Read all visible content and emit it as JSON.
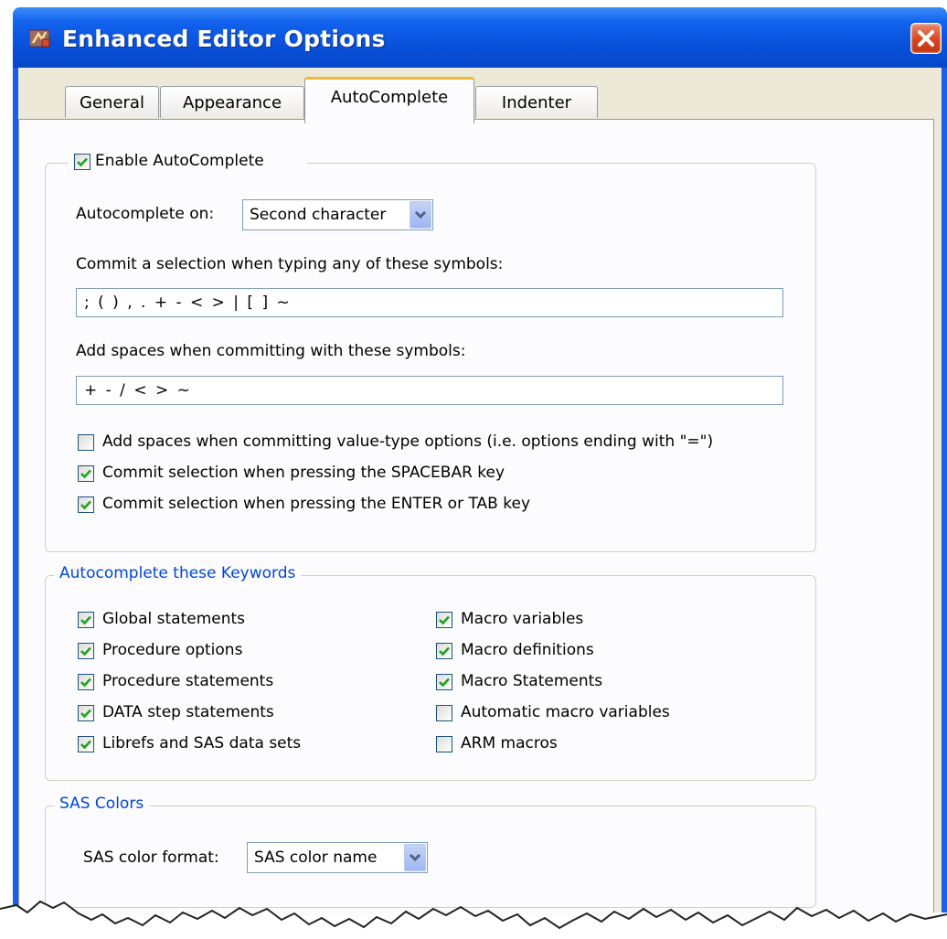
{
  "window": {
    "title": "Enhanced Editor Options",
    "close_icon": "close-icon"
  },
  "tabs": [
    {
      "label": "General",
      "active": false
    },
    {
      "label": "Appearance",
      "active": false
    },
    {
      "label": "AutoComplete",
      "active": true
    },
    {
      "label": "Indenter",
      "active": false
    }
  ],
  "autocomplete": {
    "enable_label": "Enable AutoComplete",
    "enable_checked": true,
    "on_label": "Autocomplete on:",
    "on_value": "Second character",
    "commit_label": "Commit a selection when typing any of these symbols:",
    "commit_value": "; ( ) , . + - < > | [ ] ~",
    "spaces_label": "Add spaces when committing with these symbols:",
    "spaces_value": "+ - / < > ~",
    "options": [
      {
        "label": "Add spaces when committing value-type options (i.e. options ending with \"=\")",
        "checked": false
      },
      {
        "label": "Commit selection when pressing the SPACEBAR key",
        "checked": true
      },
      {
        "label": "Commit selection when pressing the ENTER or TAB key",
        "checked": true
      }
    ]
  },
  "keywords": {
    "title": "Autocomplete these Keywords",
    "left": [
      {
        "label": "Global statements",
        "checked": true
      },
      {
        "label": "Procedure options",
        "checked": true
      },
      {
        "label": "Procedure statements",
        "checked": true
      },
      {
        "label": "DATA step statements",
        "checked": true
      },
      {
        "label": "Librefs and SAS data sets",
        "checked": true
      }
    ],
    "right": [
      {
        "label": "Macro variables",
        "checked": true
      },
      {
        "label": "Macro definitions",
        "checked": true
      },
      {
        "label": "Macro Statements",
        "checked": true
      },
      {
        "label": "Automatic macro variables",
        "checked": false
      },
      {
        "label": "ARM macros",
        "checked": false
      }
    ]
  },
  "sas_colors": {
    "title": "SAS Colors",
    "format_label": "SAS color format:",
    "format_value": "SAS color name"
  },
  "colors": {
    "title_bar": "#0a52dc",
    "panel": "#fcfcfe",
    "group_title": "#0046d5",
    "active_tab_accent": "#fab638",
    "check": "#21a121"
  }
}
